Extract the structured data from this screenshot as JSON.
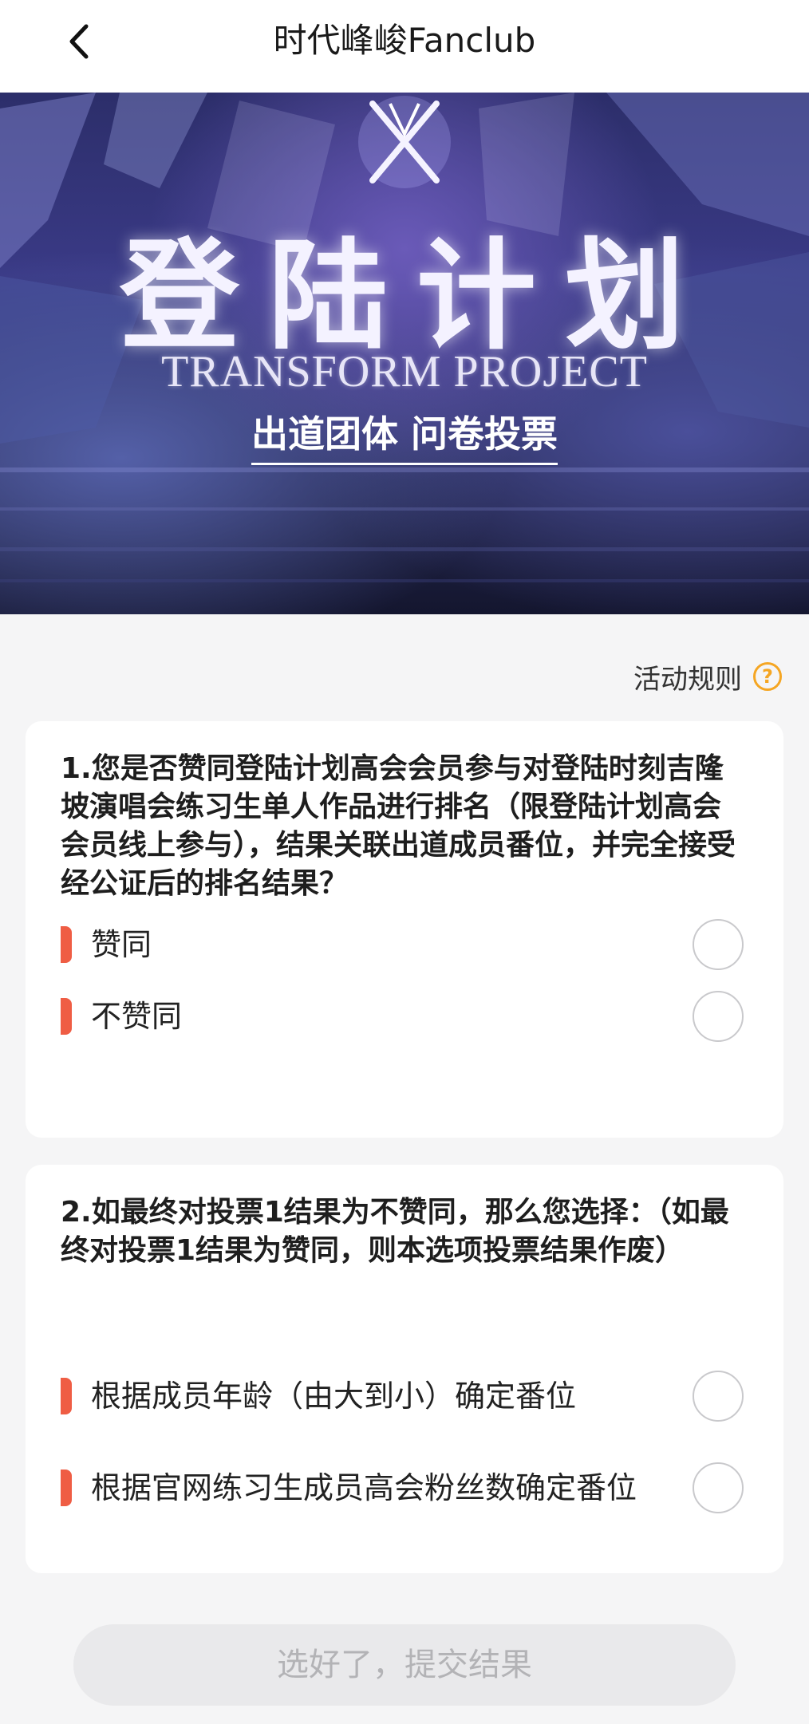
{
  "header": {
    "title": "时代峰峻Fanclub",
    "back_icon": "chevron-left-icon"
  },
  "banner": {
    "title": "登陆计划",
    "subtitle": "TRANSFORM PROJECT",
    "tagline": "出道团体 问卷投票",
    "logo_icon": "x-logo-icon"
  },
  "rules": {
    "label": "活动规则",
    "icon": "question-circle-icon",
    "icon_glyph": "?",
    "accent_color": "#f5a623"
  },
  "questions": [
    {
      "text": "1.您是否赞同登陆计划高会会员参与对登陆时刻吉隆坡演唱会练习生单人作品进行排名（限登陆计划高会会员线上参与），结果关联出道成员番位，并完全接受经公证后的排名结果？",
      "options": [
        "赞同",
        "不赞同"
      ]
    },
    {
      "text": "2.如最终对投票1结果为不赞同，那么您选择：（如最终对投票1结果为赞同，则本选项投票结果作废）",
      "options": [
        "根据成员年龄（由大到小）确定番位",
        "根据官网练习生成员高会粉丝数确定番位"
      ]
    }
  ],
  "submit": {
    "label": "选好了，提交结果"
  },
  "colors": {
    "option_marker": "#ef5d44",
    "submit_bg": "#e9e9eb",
    "submit_text": "#b3b3b6"
  }
}
